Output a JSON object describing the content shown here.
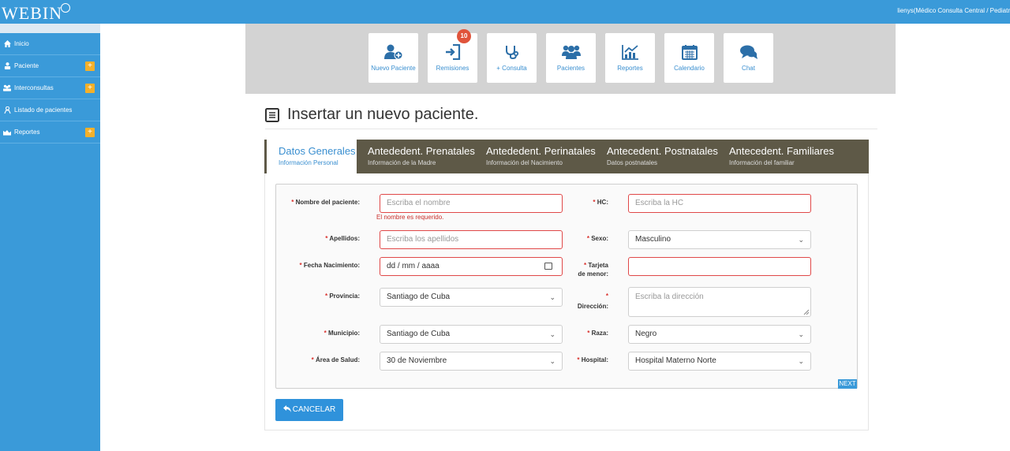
{
  "app": {
    "logo_text": "WEBIN",
    "user": "lienys(Médico Consulta Central / Pediatr"
  },
  "sidebar": {
    "items": [
      {
        "label": "Inicio",
        "icon": "home-icon",
        "expandable": false
      },
      {
        "label": "Paciente",
        "icon": "patient-icon",
        "expandable": true
      },
      {
        "label": "Interconsultas",
        "icon": "users-icon",
        "expandable": true
      },
      {
        "label": "Listado de pacientes",
        "icon": "person-icon",
        "expandable": false
      },
      {
        "label": "Reportes",
        "icon": "chart-icon",
        "expandable": true
      }
    ],
    "plus": "+"
  },
  "toolbar": {
    "items": [
      {
        "label": "Nuevo Paciente",
        "icon": "add-user-icon"
      },
      {
        "label": "Remisiones",
        "icon": "sign-in-icon",
        "badge": "10"
      },
      {
        "label": "+ Consulta",
        "icon": "stethoscope-icon"
      },
      {
        "label": "Pacientes",
        "icon": "group-icon"
      },
      {
        "label": "Reportes",
        "icon": "line-chart-icon"
      },
      {
        "label": "Calendario",
        "icon": "calendar-icon"
      },
      {
        "label": "Chat",
        "icon": "chat-icon"
      }
    ]
  },
  "page": {
    "title": "Insertar un nuevo paciente."
  },
  "tabs": [
    {
      "title": "Datos Generales",
      "subtitle": "Información Personal",
      "active": true
    },
    {
      "title": "Antededent. Prenatales",
      "subtitle": "Información de la Madre",
      "active": false
    },
    {
      "title": "Antededent. Perinatales",
      "subtitle": "Información del Nacimiento",
      "active": false
    },
    {
      "title": "Antecedent. Postnatales",
      "subtitle": "Datos postnatales",
      "active": false
    },
    {
      "title": "Antecedent. Familiares",
      "subtitle": "Información del familiar",
      "active": false
    }
  ],
  "form": {
    "required_mark": "*",
    "nombre": {
      "label": "Nombre del paciente:",
      "placeholder": "Escriba el nombre",
      "error": "El nombre es requerido."
    },
    "hc": {
      "label": "HC:",
      "placeholder": "Escriba la HC"
    },
    "apellidos": {
      "label": "Apellidos:",
      "placeholder": "Escriba los apellidos"
    },
    "sexo": {
      "label": "Sexo:",
      "value": "Masculino"
    },
    "fecha": {
      "label": "Fecha Nacimiento:",
      "placeholder": "dd / mm / aaaa"
    },
    "tarjeta": {
      "label_line1": "Tarjeta",
      "label_line2": "de menor:",
      "value": ""
    },
    "provincia": {
      "label": "Provincia:",
      "value": "Santiago de Cuba"
    },
    "direccion": {
      "label": "Dirección:",
      "placeholder": "Escriba la dirección"
    },
    "municipio": {
      "label": "Municipio:",
      "value": "Santiago de Cuba"
    },
    "raza": {
      "label": "Raza:",
      "value": "Negro"
    },
    "area": {
      "label": "Área de Salud:",
      "value": "30 de Noviembre"
    },
    "hospital": {
      "label": "Hospital:",
      "value": "Hospital Materno Norte"
    }
  },
  "buttons": {
    "next": "NEXT",
    "cancel": "CANCELAR"
  },
  "colors": {
    "primary": "#3a9ad9",
    "tab_bar": "#5e5947",
    "error": "#e04848",
    "badge": "#e0543b",
    "plus": "#f4b02a"
  }
}
